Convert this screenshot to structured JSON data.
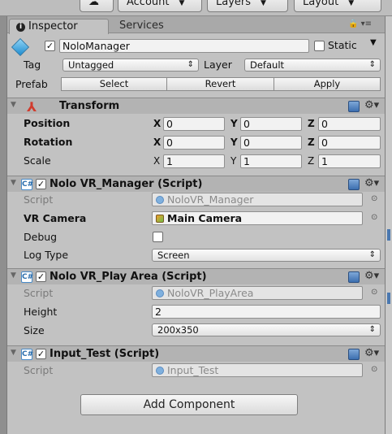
{
  "toolbar": {
    "account_label": "Account",
    "layers_label": "Layers",
    "layout_label": "Layout"
  },
  "tabs": {
    "inspector": "Inspector",
    "services": "Services"
  },
  "gameobject": {
    "name": "NoloManager",
    "static_label": "Static",
    "tag_label": "Tag",
    "tag_value": "Untagged",
    "layer_label": "Layer",
    "layer_value": "Default",
    "prefab_label": "Prefab",
    "prefab_buttons": [
      "Select",
      "Revert",
      "Apply"
    ]
  },
  "transform": {
    "title": "Transform",
    "rows": [
      {
        "label": "Position",
        "x": "0",
        "y": "0",
        "z": "0",
        "bold": true
      },
      {
        "label": "Rotation",
        "x": "0",
        "y": "0",
        "z": "0",
        "bold": true
      },
      {
        "label": "Scale",
        "x": "1",
        "y": "1",
        "z": "1",
        "bold": false
      }
    ]
  },
  "components": [
    {
      "title": "Nolo VR_Manager (Script)",
      "script_label": "Script",
      "script_value": "NoloVR_Manager",
      "fields": [
        {
          "label": "VR Camera",
          "value": "Main Camera"
        },
        {
          "label": "Debug",
          "value": ""
        },
        {
          "label": "Log Type",
          "value": "Screen"
        }
      ]
    },
    {
      "title": "Nolo VR_Play Area (Script)",
      "script_label": "Script",
      "script_value": "NoloVR_PlayArea",
      "fields": [
        {
          "label": "Height",
          "value": "2"
        },
        {
          "label": "Size",
          "value": "200x350"
        }
      ]
    },
    {
      "title": "Input_Test (Script)",
      "script_label": "Script",
      "script_value": "Input_Test"
    }
  ],
  "add_component_label": "Add Component"
}
